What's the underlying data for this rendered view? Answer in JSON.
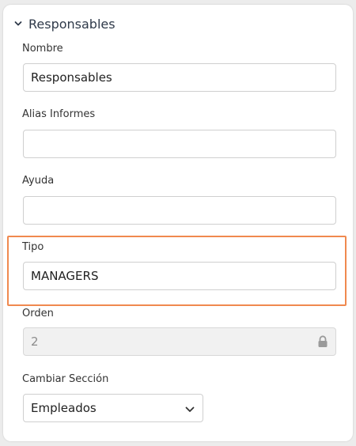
{
  "section": {
    "title": "Responsables",
    "expanded_icon": "chevron-down-icon"
  },
  "fields": {
    "nombre": {
      "label": "Nombre",
      "value": "Responsables",
      "placeholder": ""
    },
    "alias": {
      "label": "Alias Informes",
      "value": "",
      "placeholder": ""
    },
    "ayuda": {
      "label": "Ayuda",
      "value": "",
      "placeholder": ""
    },
    "tipo": {
      "label": "Tipo",
      "value": "MANAGERS",
      "placeholder": ""
    },
    "orden": {
      "label": "Orden",
      "value": "2",
      "placeholder": "",
      "locked_icon": "lock-icon"
    },
    "cambiar_seccion": {
      "label": "Cambiar Sección",
      "selected": "Empleados"
    }
  },
  "colors": {
    "highlight": "#f0894f",
    "disabled_bg": "#f1f1f1"
  }
}
